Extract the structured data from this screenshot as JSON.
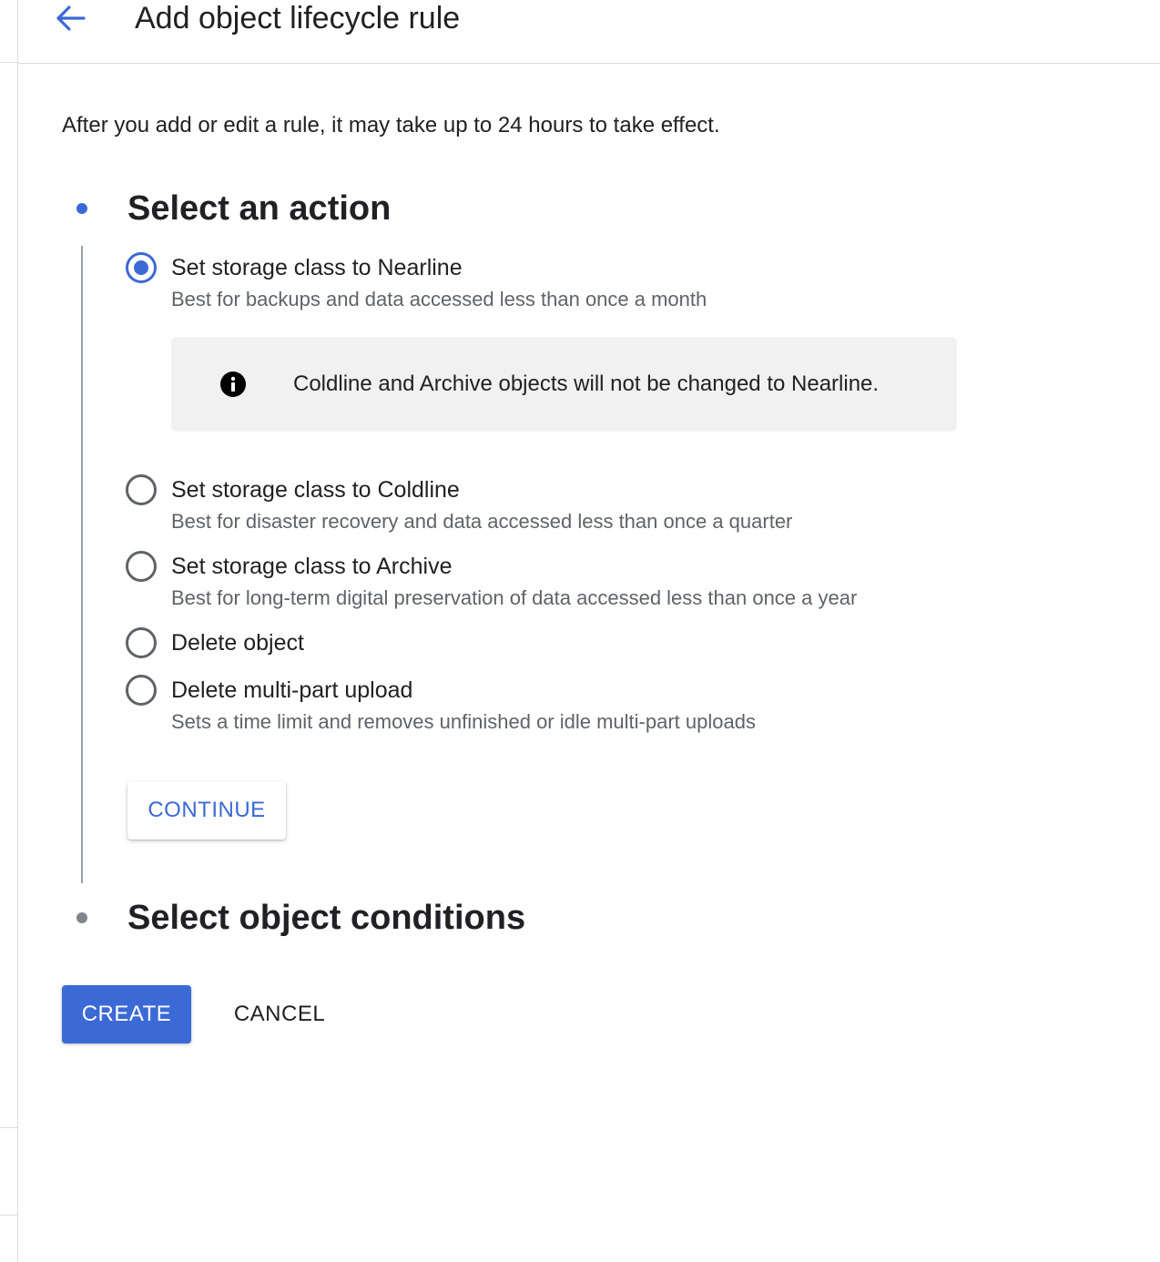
{
  "header": {
    "title": "Add object lifecycle rule",
    "back_icon": "arrow-left-icon"
  },
  "notice": "After you add or edit a rule, it may take up to 24 hours to take effect.",
  "steps": [
    {
      "title": "Select an action",
      "state": "active"
    },
    {
      "title": "Select object conditions",
      "state": "inactive"
    }
  ],
  "actions": [
    {
      "label": "Set storage class to Nearline",
      "description": "Best for backups and data accessed less than once a month",
      "selected": true
    },
    {
      "label": "Set storage class to Coldline",
      "description": "Best for disaster recovery and data accessed less than once a quarter",
      "selected": false
    },
    {
      "label": "Set storage class to Archive",
      "description": "Best for long-term digital preservation of data accessed less than once a year",
      "selected": false
    },
    {
      "label": "Delete object",
      "description": "",
      "selected": false
    },
    {
      "label": "Delete multi-part upload",
      "description": "Sets a time limit and removes unfinished or idle multi-part uploads",
      "selected": false
    }
  ],
  "info": {
    "icon": "info-icon",
    "text": "Coldline and Archive objects will not be changed to Nearline."
  },
  "buttons": {
    "continue": "CONTINUE",
    "create": "CREATE",
    "cancel": "CANCEL"
  },
  "colors": {
    "accent": "#3b69d6",
    "inactive_dot": "#80868b",
    "info_bg": "#f1f1f1"
  }
}
